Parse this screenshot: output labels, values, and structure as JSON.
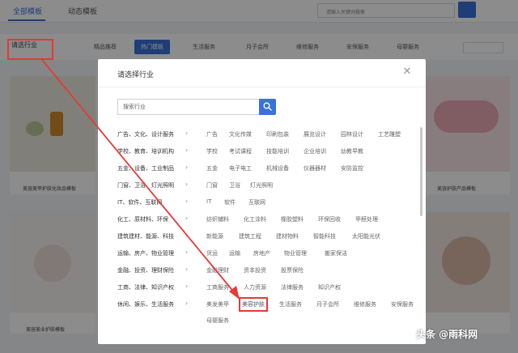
{
  "modal": {
    "title": "请选择行业",
    "search_placeholder": "搜索行业",
    "categories": [
      {
        "label": "广告、文化、设计服务",
        "subs": [
          "广告",
          "文化传媒",
          "印刷包装",
          "展览设计",
          "园林设计",
          "工艺雕塑"
        ]
      },
      {
        "label": "学校、教育、培训机构",
        "subs": [
          "学校",
          "考试课程",
          "技能培训",
          "企业培训",
          "幼教早教"
        ]
      },
      {
        "label": "五金、设备、工业制品",
        "subs": [
          "五金",
          "电子电工",
          "机械设备",
          "仪器器材",
          "安防监控"
        ]
      },
      {
        "label": "门窗、卫浴、灯光照明",
        "subs": [
          "门窗",
          "卫浴",
          "灯光照明"
        ]
      },
      {
        "label": "IT、软件、互联网",
        "subs": [
          "IT",
          "软件",
          "互联网"
        ]
      },
      {
        "label": "化工、原材料、环保",
        "subs": [
          "纺织辅料",
          "化工涂料",
          "橡胶塑料",
          "环保回收",
          "甲醛处理"
        ]
      },
      {
        "label": "建筑建材、能源、科技",
        "subs": [
          "新能源",
          "建筑工程",
          "建材物料",
          "智能科技",
          "太阳能光伏"
        ]
      },
      {
        "label": "运输、房产、物业管理",
        "subs": [
          "货运",
          "运输",
          "房地产",
          "物业管理",
          "搬家保洁"
        ]
      },
      {
        "label": "金融、投资、理财保险",
        "subs": [
          "金融理财",
          "资本投资",
          "股票保险"
        ]
      },
      {
        "label": "工商、法律、知识产权",
        "subs": [
          "工商服务",
          "人力资源",
          "法律服务",
          "知识产权"
        ]
      },
      {
        "label": "休闲、娱乐、生活服务",
        "subs": [
          "美发美甲",
          "美容护肤",
          "生活服务",
          "月子会所",
          "维修服务",
          "安保服务",
          "母婴服务"
        ]
      }
    ],
    "highlighted_sub": "美容护肤"
  },
  "background": {
    "tabs": [
      "全部模板",
      "动态模板"
    ],
    "search_placeholder": "请输入关键词搜索",
    "industry_selector": "请选行业",
    "categories": [
      "精品推荐",
      "热门模板",
      "生活服务",
      "月子会所",
      "维修服务",
      "安保服务",
      "母婴服务"
    ],
    "captions": [
      "美容美甲护肤化妆品模板",
      "美容护肤产品模板",
      "美容美业护肤模板"
    ]
  },
  "watermark": "头条 @雨科网"
}
